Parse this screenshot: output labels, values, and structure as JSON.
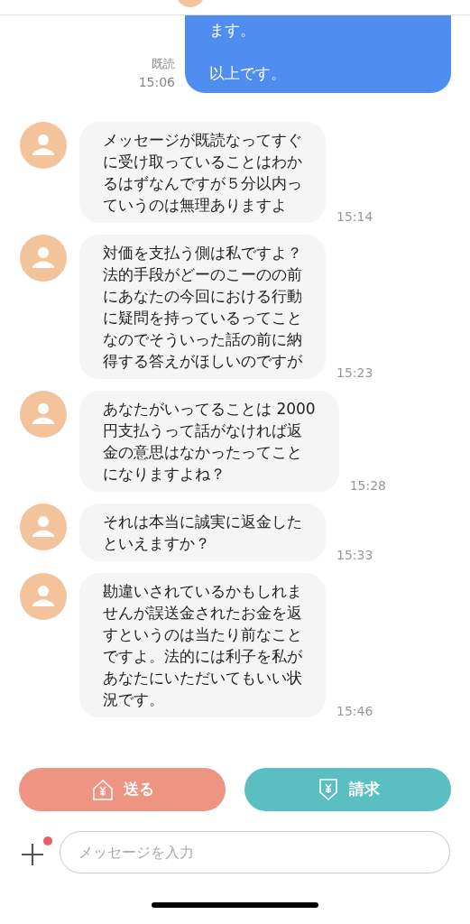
{
  "sent_message": {
    "paragraphs": [
      "ます。",
      "以上です。"
    ],
    "read_label": "既読",
    "time": "15:06"
  },
  "messages": [
    {
      "lines": [
        "メッセージが既読なってすぐ",
        "に受け取っていることはわか",
        "るはずなんですが５分以内っ",
        "ていうのは無理ありますよ"
      ],
      "time": "15:14"
    },
    {
      "lines": [
        "対価を支払う側は私ですよ？",
        "法的手段がどーのこーのの前",
        "にあなたの今回における行動",
        "に疑問を持っているってこと",
        "なのでそういった話の前に納",
        "得する答えがほしいのですが"
      ],
      "time": "15:23"
    },
    {
      "lines": [
        "あなたがいってることは 2000",
        "円支払うって話がなければ返",
        "金の意思はなかったってこと",
        "になりますよね？"
      ],
      "time": "15:28"
    },
    {
      "lines": [
        "それは本当に誠実に返金した",
        "といえますか？"
      ],
      "time": "15:33"
    },
    {
      "lines": [
        "勘違いされているかもしれま",
        "せんが誤送金されたお金を返",
        "すというのは当たり前なこと",
        "ですよ。法的には利子を私が",
        "あなたにいただいてもいい状",
        "況です。"
      ],
      "time": "15:46"
    }
  ],
  "actions": [
    {
      "kind": "send",
      "label": "送る"
    },
    {
      "kind": "request",
      "label": "請求"
    }
  ],
  "composer": {
    "placeholder": "メッセージを入力",
    "has_notification": true
  }
}
